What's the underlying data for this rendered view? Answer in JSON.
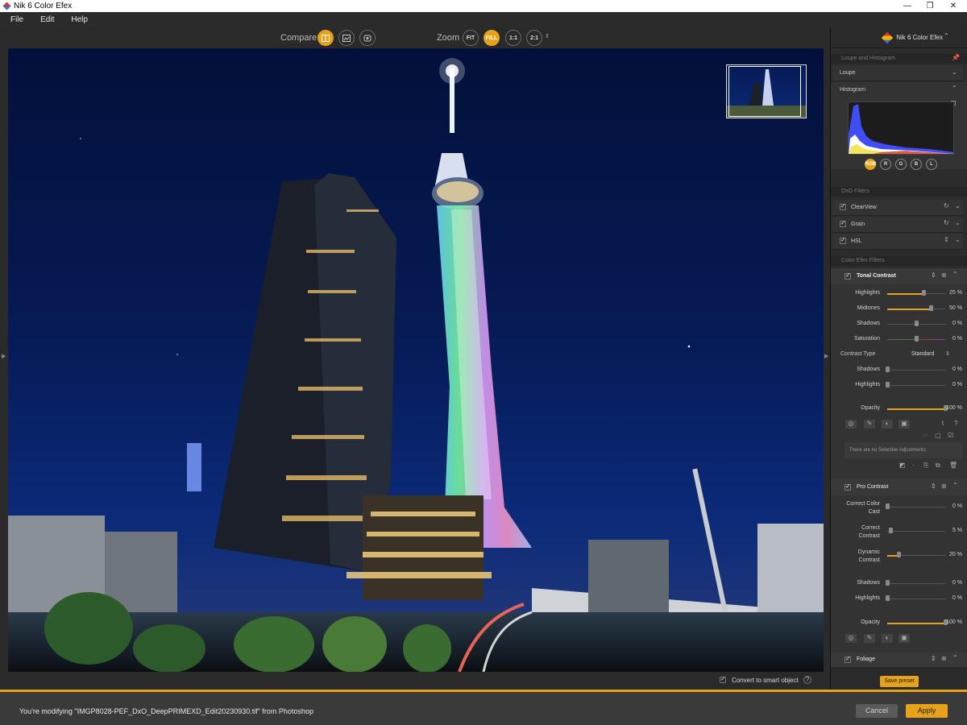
{
  "window": {
    "title": "Nik 6 Color Efex",
    "min": "—",
    "max": "❐",
    "close": "✕"
  },
  "menu": [
    "File",
    "Edit",
    "Help"
  ],
  "toolbar": {
    "compare_label": "Compare",
    "zoom_label": "Zoom",
    "zoom_buttons": [
      "FIT",
      "FILL",
      "1:1",
      "2:1"
    ],
    "zoom_active": "FILL"
  },
  "panel": {
    "app_name": "Nik 6 Color Efex",
    "loupe_histogram_label": "Loupe and Histogram",
    "loupe_label": "Loupe",
    "histogram_label": "Histogram",
    "channels": [
      "RGB",
      "R",
      "G",
      "B",
      "L"
    ],
    "dxo_filters_label": "DxO Filters",
    "dxo_filters": [
      "ClearView",
      "Grain",
      "HSL"
    ],
    "color_efex_label": "Color Efex Filters",
    "tonal_contrast": {
      "title": "Tonal Contrast",
      "sliders": [
        {
          "label": "Highlights",
          "value": "25 %",
          "level": 0.62
        },
        {
          "label": "Midtones",
          "value": "50 %",
          "level": 0.75
        },
        {
          "label": "Shadows",
          "value": "0 %",
          "level": 0.5
        },
        {
          "label": "Saturation",
          "value": "0 %",
          "level": 0.5
        }
      ],
      "contrast_type_label": "Contrast Type",
      "contrast_type_value": "Standard",
      "sub_sliders": [
        {
          "label": "Shadows",
          "value": "0 %",
          "level": 0.0
        },
        {
          "label": "Highlights",
          "value": "0 %",
          "level": 0.0
        }
      ],
      "opacity_label": "Opacity",
      "opacity_value": "100 %",
      "no_selective": "There are no Selective Adjustments"
    },
    "pro_contrast": {
      "title": "Pro Contrast",
      "sliders": [
        {
          "label": "Correct Color Cast",
          "value": "0 %",
          "level": 0.0
        },
        {
          "label": "Correct Contrast",
          "value": "5 %",
          "level": 0.05
        },
        {
          "label": "Dynamic Contrast",
          "value": "20 %",
          "level": 0.2
        }
      ],
      "sub_sliders": [
        {
          "label": "Shadows",
          "value": "0 %",
          "level": 0.0
        },
        {
          "label": "Highlights",
          "value": "0 %",
          "level": 0.0
        }
      ],
      "opacity_label": "Opacity",
      "opacity_value": "100 %"
    },
    "foliage_title": "Foliage",
    "save_preset": "Save preset"
  },
  "convert_label": "Convert to smart object",
  "footer": {
    "message": "You're modifying \"IMGP8028-PEF_DxO_DeepPRIMEXD_Edit20230930.tif\" from Photoshop",
    "cancel": "Cancel",
    "apply": "Apply"
  },
  "colors": {
    "accent": "#e5a21a"
  }
}
